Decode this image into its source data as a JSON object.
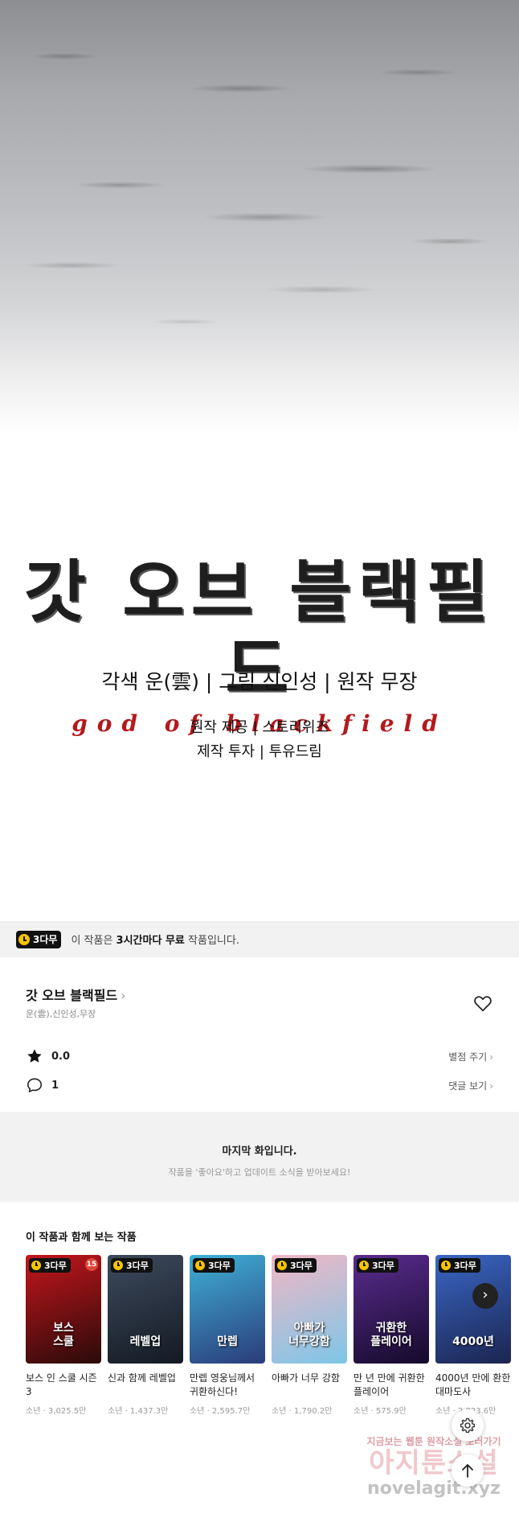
{
  "comic": {
    "title_ko": "갓 오브 블랙필드",
    "title_en": "god of blackfield",
    "credits_main": "각색 운(雲) | 그림 신인성 | 원작 무장",
    "credits_line1": "원작 제공 | 스토리위즈",
    "credits_line2": "제작 투자 | 투유드림"
  },
  "banner": {
    "badge": "3다무",
    "text_before": "이 작품은 ",
    "text_bold": "3시간마다 무료",
    "text_after": " 작품입니다."
  },
  "series": {
    "title": "갓 오브 블랙필드",
    "authors": "운(雲),신인성,무장",
    "rating": "0.0",
    "comments": "1",
    "rate_link": "별점 주기",
    "comment_link": "댓글 보기"
  },
  "last_episode": {
    "title": "마지막 화입니다.",
    "subtitle": "작품을 '좋아요'하고 업데이트 소식을 받아보세요!"
  },
  "recommendations": {
    "heading": "이 작품과 함께 보는 작품",
    "badge": "3다무",
    "items": [
      {
        "title": "보스 인 스쿨 시즌 3",
        "meta": "소년 · 3,025.5만",
        "cover_text": "보스\n스쿨",
        "age": "15",
        "color_a": "#c4161c",
        "color_b": "#2a0a0a"
      },
      {
        "title": "신과 함께 레벨업",
        "meta": "소년 · 1,437.3만",
        "cover_text": "레벨업",
        "age": "",
        "color_a": "#3d4a5c",
        "color_b": "#141a24"
      },
      {
        "title": "만렙 영웅님께서 귀환하신다!",
        "meta": "소년 · 2,595.7만",
        "cover_text": "만렙",
        "age": "",
        "color_a": "#3fb0d6",
        "color_b": "#2a3c7a"
      },
      {
        "title": "아빠가 너무 강함",
        "meta": "소년 · 1,790.2만",
        "cover_text": "아빠가\n너무강함",
        "age": "",
        "color_a": "#f1b7c4",
        "color_b": "#7ec6e8"
      },
      {
        "title": "만 년 만에 귀환한 플레이어",
        "meta": "소년 · 575.9만",
        "cover_text": "귀환한\n플레이어",
        "age": "",
        "color_a": "#5b2c8f",
        "color_b": "#140a2a"
      },
      {
        "title": "4000년 만에 환한 대마도사",
        "meta": "소년 · 2,023.6만",
        "cover_text": "4000년",
        "age": "",
        "color_a": "#3a66c4",
        "color_b": "#1b2550"
      }
    ]
  },
  "watermark": {
    "line1": "지금보는 웹툰 원작소설 보러가기",
    "line2": "아지툰소설",
    "line3": "novelagit.xyz"
  },
  "icons": {
    "clock": "clock-icon",
    "heart": "heart-icon",
    "star": "star-icon",
    "comment": "comment-icon",
    "next": "chevron-right-icon",
    "gear": "gear-icon",
    "up": "arrow-up-icon"
  }
}
